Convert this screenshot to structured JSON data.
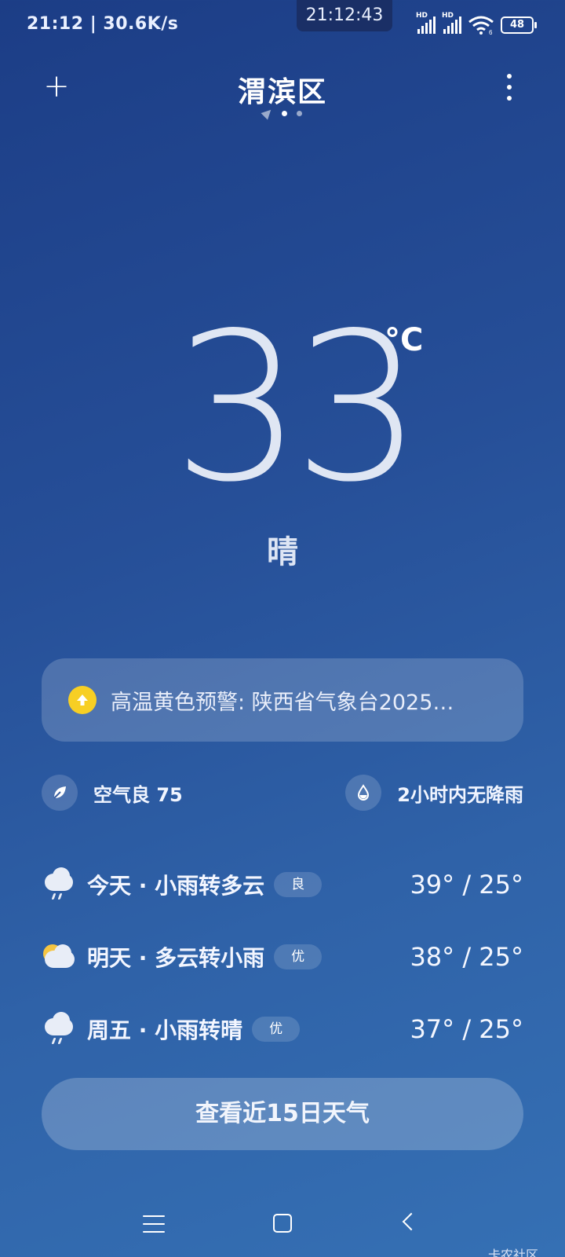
{
  "status_bar": {
    "left_text": "21:12 | 30.6K/s",
    "center_time": "21:12:43",
    "sim_labels": [
      "HD",
      "HD"
    ],
    "wifi_sub": "6",
    "battery": "48"
  },
  "header": {
    "city": "渭滨区",
    "add_symbol": "+",
    "pages": 3,
    "active_page": 1
  },
  "current": {
    "temperature": "33",
    "unit": "°C",
    "condition": "晴"
  },
  "alert": {
    "text": "高温黄色预警: 陕西省气象台2025…",
    "color": "#f7cf24"
  },
  "info": {
    "air": "空气良 75",
    "rain": "2小时内无降雨"
  },
  "forecast": [
    {
      "day": "今天 · 小雨转多云",
      "aqi": "良",
      "range": "39° / 25°",
      "icon": "rain-cloud-icon"
    },
    {
      "day": "明天 · 多云转小雨",
      "aqi": "优",
      "range": "38° / 25°",
      "icon": "sun-cloud-icon"
    },
    {
      "day": "周五 · 小雨转晴",
      "aqi": "优",
      "range": "37° / 25°",
      "icon": "rain-cloud-icon"
    }
  ],
  "button_15day": "查看近15日天气",
  "watermark": "卡农社区",
  "colors": {
    "accent_alert": "#f7cf24",
    "background_top": "#1c3d86",
    "background_bottom": "#3570b4"
  }
}
